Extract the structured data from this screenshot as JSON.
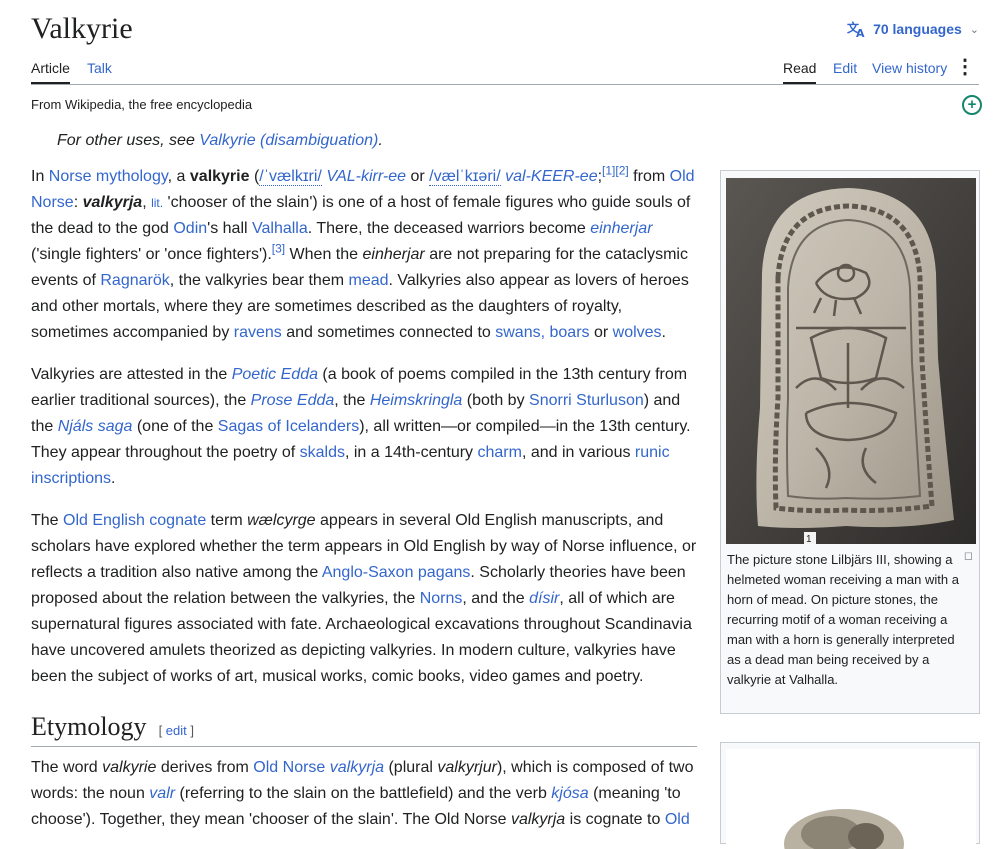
{
  "page": {
    "title": "Valkyrie",
    "languages": "70 languages",
    "tabs_left": [
      "Article",
      "Talk"
    ],
    "tabs_right": [
      "Read",
      "Edit",
      "View history"
    ],
    "tagline": "From Wikipedia, the free encyclopedia"
  },
  "hatnote": {
    "prefix": "For other uses, see ",
    "link": "Valkyrie (disambiguation)",
    "suffix": "."
  },
  "p1": {
    "t1": "In ",
    "l_norse_myth": "Norse mythology",
    "t2": ", a ",
    "b_valkyrie": "valkyrie",
    "t3": " (",
    "ipa1": "/ˈvælkɪri/",
    "resp1": "VAL-kirr-ee",
    "t4": " or ",
    "ipa2": "/vælˈkɪəri/",
    "resp2": "val-KEER-ee",
    "t5": ";",
    "ref1": "[1]",
    "ref2": "[2]",
    "t6": " from ",
    "l_old_norse": "Old Norse",
    "t7": ": ",
    "valkyrja": "valkyrja",
    "t8": ", ",
    "lit": "lit.",
    "t9": " 'chooser of the slain') is one of a host of female figures who guide souls of the dead to the god ",
    "l_odin": "Odin",
    "t10": "'s hall ",
    "l_valhalla": "Valhalla",
    "t11": ". There, the deceased warriors become ",
    "l_einherjar": "einherjar",
    "t12": " ('single fighters' or 'once fighters').",
    "ref3": "[3]",
    "t13": " When the ",
    "i_einherjar": "einherjar",
    "t14": " are not preparing for the cataclysmic events of ",
    "l_ragnarok": "Ragnarök",
    "t15": ", the valkyries bear them ",
    "l_mead": "mead",
    "t16": ". Valkyries also appear as lovers of heroes and other mortals, where they are sometimes described as the daughters of royalty, sometimes accompanied by ",
    "l_ravens": "ravens",
    "t17": " and sometimes connected to ",
    "l_swans": "swans, boars",
    "t18": " or ",
    "l_wolves": "wolves",
    "t19": "."
  },
  "p2": {
    "t1": "Valkyries are attested in the ",
    "l_poetic": "Poetic Edda",
    "t2": " (a book of poems compiled in the 13th century from earlier traditional sources), the ",
    "l_prose": "Prose Edda",
    "t3": ", the ",
    "l_heims": "Heimskringla",
    "t4": " (both by ",
    "l_snorri": "Snorri Sturluson",
    "t5": ") and the ",
    "l_njals": "Njáls saga",
    "t6": " (one of the ",
    "l_sagas": "Sagas of Icelanders",
    "t7": "), all written—or compiled—in the 13th century. They appear throughout the poetry of ",
    "l_skalds": "skalds",
    "t8": ", in a 14th-century ",
    "l_charm": "charm",
    "t9": ", and in various ",
    "l_runic": "runic inscriptions",
    "t10": "."
  },
  "p3": {
    "t1": "The ",
    "l_oe_cognate": "Old English cognate",
    "t2": " term ",
    "i_waelcyrge": "wælcyrge",
    "t3": " appears in several Old English manuscripts, and scholars have explored whether the term appears in Old English by way of Norse influence, or reflects a tradition also native among the ",
    "l_anglo": "Anglo-Saxon pagans",
    "t4": ". Scholarly theories have been proposed about the relation between the valkyries, the ",
    "l_norns": "Norns",
    "t5": ", and the ",
    "l_disir": "dísir",
    "t6": ", all of which are supernatural figures associated with fate. Archaeological excavations throughout Scandinavia have uncovered amulets theorized as depicting valkyries. In modern culture, valkyries have been the subject of works of art, musical works, comic books, video games and poetry."
  },
  "etym": {
    "heading": "Etymology",
    "edit_open": "[ ",
    "edit": "edit",
    "edit_close": " ]",
    "t1": "The word ",
    "i_valkyrie": "valkyrie",
    "t2": " derives from ",
    "l_old_norse": "Old Norse",
    "t3": " ",
    "l_valkyrja": "valkyrja",
    "t4": " (plural ",
    "i_valkyrjur": "valkyrjur",
    "t5": "), which is composed of two words: the noun ",
    "l_valr": "valr",
    "t6": " (referring to the slain on the battlefield) and the verb ",
    "l_kjosa": "kjósa",
    "t7": " (meaning 'to choose'). Together, they mean 'chooser of the slain'. The Old Norse ",
    "i_valkyrja2": "valkyrja",
    "t8": " is cognate to ",
    "l_old": "Old"
  },
  "figure": {
    "caption": "The picture stone Lilbjärs III, showing a helmeted woman receiving a man with a horn of mead. On picture stones, the recurring motif of a woman receiving a man with a horn is generally interpreted as a dead man being received by a valkyrie at Valhalla.",
    "stone_label": "1"
  },
  "colors": {
    "link": "#3366cc",
    "text": "#202122",
    "border": "#a2a9b1",
    "addbutton": "#14866d"
  }
}
